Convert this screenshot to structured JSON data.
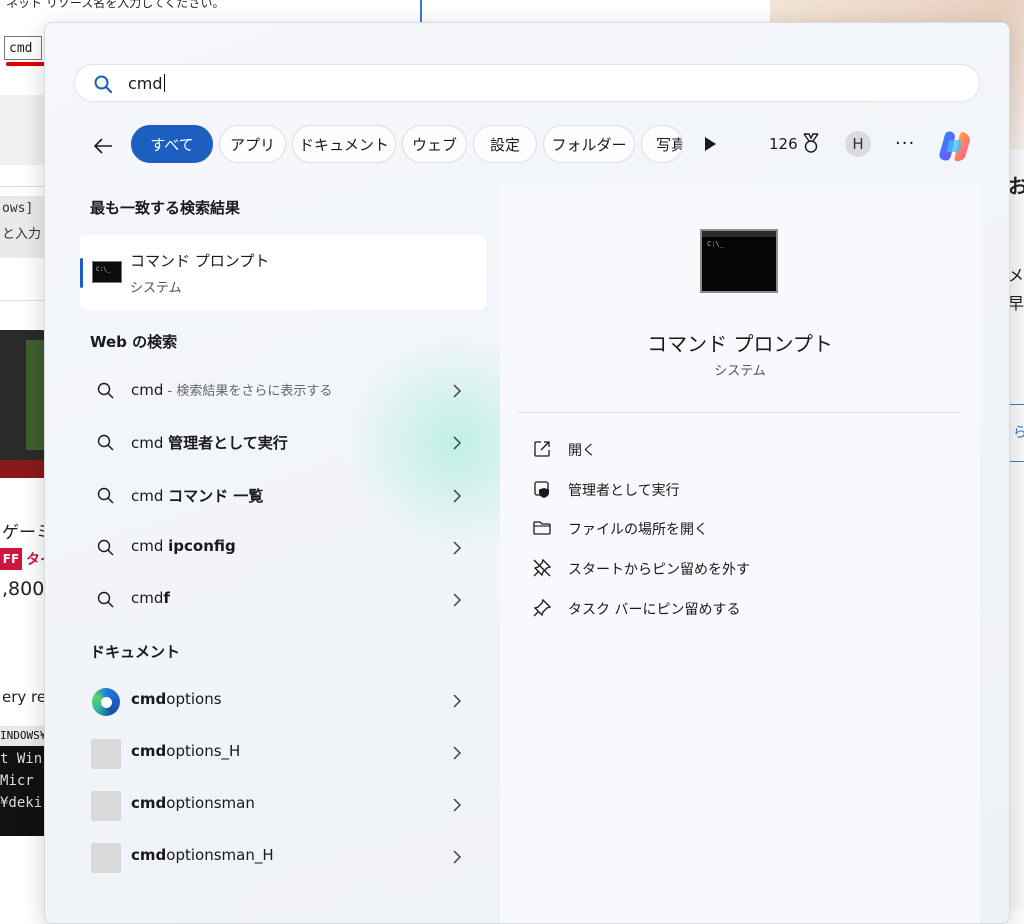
{
  "background": {
    "hint_text": "ネット リソース名を入力してください。",
    "input_value": "cmd",
    "code_lines": [
      "ows]",
      "と入力"
    ],
    "product_text": "ゲーミ",
    "off_badge": "FF",
    "off_text": "タイ",
    "price": ",800",
    "desc_text": "ery rep",
    "terminal_title": "INDOWS¥",
    "terminal_lines": [
      "t Win",
      "Micr",
      "",
      "¥deki"
    ],
    "right_chars": [
      "お",
      "メ",
      "早"
    ],
    "right_box_char": "ら"
  },
  "search": {
    "query": "cmd",
    "filters": [
      "すべて",
      "アプリ",
      "ドキュメント",
      "ウェブ",
      "設定",
      "フォルダー",
      "写真"
    ],
    "active_filter": "すべて",
    "points": "126",
    "avatar_letter": "H",
    "more_label": "···"
  },
  "best_match": {
    "section_title": "最も一致する検索結果",
    "name": "コマンド プロンプト",
    "type": "システム"
  },
  "web": {
    "section_title": "Web の検索",
    "items": [
      {
        "prefix": "cmd",
        "bold": "",
        "dim": " - 検索結果をさらに表示する"
      },
      {
        "prefix": "cmd ",
        "bold": "管理者として実行",
        "dim": ""
      },
      {
        "prefix": "cmd ",
        "bold": "コマンド 一覧",
        "dim": ""
      },
      {
        "prefix": "cmd ",
        "bold": "ipconfig",
        "dim": ""
      },
      {
        "prefix": "cmd",
        "bold": "f",
        "dim": ""
      }
    ]
  },
  "documents": {
    "section_title": "ドキュメント",
    "items": [
      {
        "bold": "cmd",
        "rest": "options",
        "icon": "edge-icon"
      },
      {
        "bold": "cmd",
        "rest": "options_H",
        "icon": "document-icon"
      },
      {
        "bold": "cmd",
        "rest": "optionsman",
        "icon": "document-icon"
      },
      {
        "bold": "cmd",
        "rest": "optionsman_H",
        "icon": "document-icon"
      }
    ]
  },
  "preview": {
    "title": "コマンド プロンプト",
    "subtitle": "システム",
    "actions": [
      {
        "label": "開く",
        "icon": "open-external-icon"
      },
      {
        "label": "管理者として実行",
        "icon": "shield-icon"
      },
      {
        "label": "ファイルの場所を開く",
        "icon": "folder-icon"
      },
      {
        "label": "スタートからピン留めを外す",
        "icon": "unpin-icon"
      },
      {
        "label": "タスク バーにピン留めする",
        "icon": "pin-icon"
      }
    ]
  },
  "colors": {
    "accent": "#1d5fc1",
    "panel_bg": "#f3f5f9",
    "underline_red": "#dd0000"
  }
}
